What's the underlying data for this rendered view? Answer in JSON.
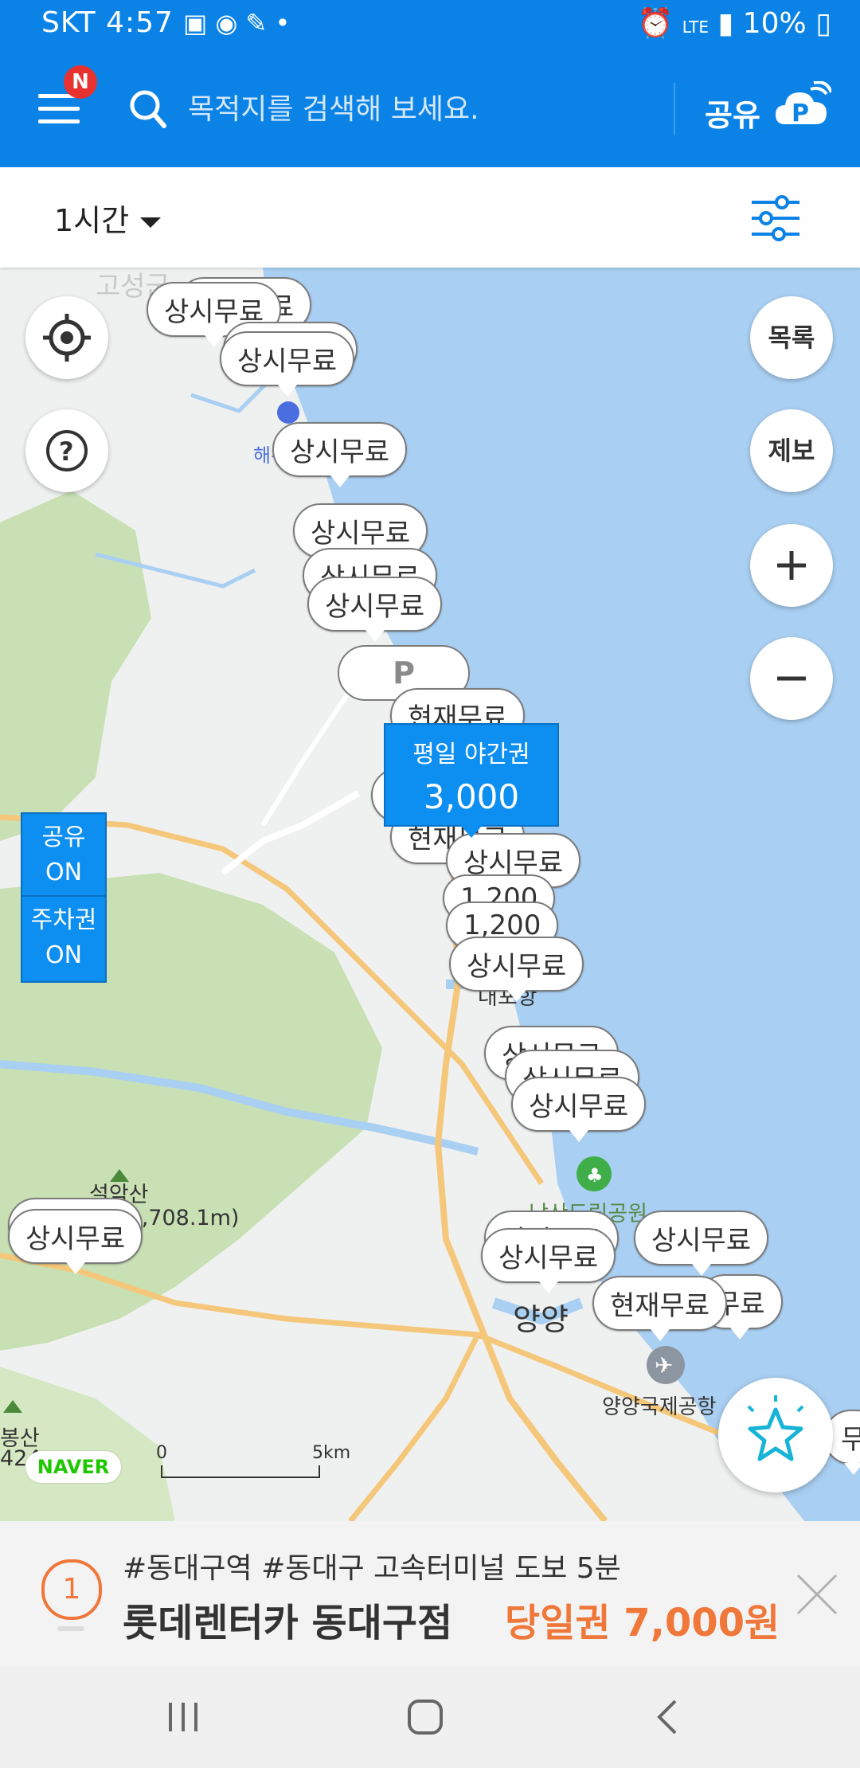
{
  "status_bar": {
    "carrier_time": "SKT 4:57",
    "battery": "10%",
    "network": "LTE"
  },
  "header": {
    "search_placeholder": "목적지를 검색해 보세요.",
    "notification_badge": "N",
    "share_label": "공유",
    "share_logo_letter": "P"
  },
  "filter": {
    "time_label": "1시간"
  },
  "map": {
    "selected_pin": {
      "line1": "평일 야간권",
      "line2": "3,000"
    },
    "pins": [
      "상시무료",
      "상시무료",
      "상시무료",
      "상시무료",
      "상시무료",
      "현재무료",
      "1,200",
      "1,200",
      "상시무료",
      "상시무료",
      "상시무료",
      "상시무료",
      "상시무료",
      "현재무료",
      "무료",
      "상시무료",
      "현재무료",
      "무",
      "상시무료"
    ],
    "p_pin": "P",
    "buttons": {
      "list": "목록",
      "report": "제보"
    },
    "toggles": {
      "share_label": "공유",
      "share_state": "ON",
      "ticket_label": "주차권",
      "ticket_state": "ON"
    },
    "labels": {
      "yangyang": "양양",
      "airport": "양양국제공항",
      "daepohang": "대포항",
      "goseong": "고성군",
      "seoraksan": "설악산",
      "seoraksan_height": "(1,708.1m)",
      "bongsan": "봉산",
      "bongsan_height": "424",
      "beach": "해수욕장",
      "park": "낙산도립공원"
    },
    "scale": {
      "zero": "0",
      "five": "5km"
    },
    "naver": "NAVER"
  },
  "ad": {
    "number": "1",
    "tags": "#동대구역  #동대구 고속터미널 도보 5분",
    "title": "롯데렌터카 동대구점",
    "price": "당일권 7,000원"
  },
  "colors": {
    "brand_blue": "#0b83e6",
    "sea": "#a9cff2",
    "forest": "#c8e0b4",
    "road": "#f5c77a",
    "accent_orange": "#f0773a"
  },
  "icons": [
    "menu-icon",
    "search-icon",
    "share-p-logo-icon",
    "settings-sliders-icon",
    "locate-icon",
    "help-icon",
    "plus-icon",
    "minus-icon",
    "star-icon",
    "close-icon",
    "mountain-icon",
    "park-icon",
    "airport-icon"
  ]
}
